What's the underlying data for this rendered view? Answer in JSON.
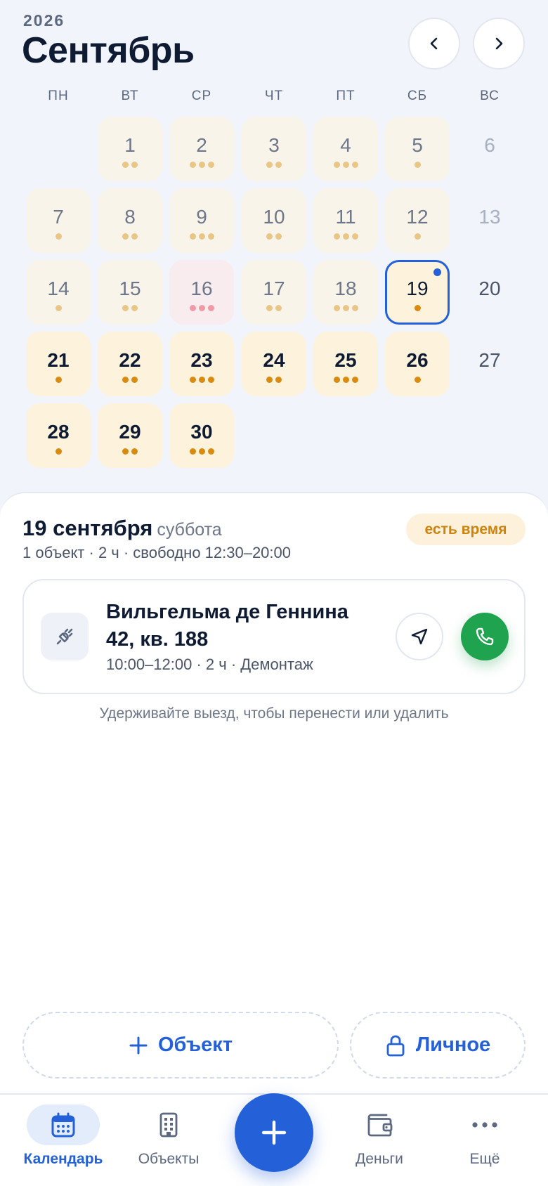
{
  "header": {
    "year": "2026",
    "month": "Сентябрь"
  },
  "weekdays": [
    "ПН",
    "ВТ",
    "СР",
    "ЧТ",
    "ПТ",
    "СБ",
    "ВС"
  ],
  "days": [
    {
      "day": "1",
      "dots": 2,
      "state": "past"
    },
    {
      "day": "2",
      "dots": 3,
      "state": "past"
    },
    {
      "day": "3",
      "dots": 2,
      "state": "past"
    },
    {
      "day": "4",
      "dots": 3,
      "state": "past"
    },
    {
      "day": "5",
      "dots": 1,
      "state": "past"
    },
    {
      "day": "6",
      "dots": 0,
      "state": "empty-past"
    },
    {
      "day": "7",
      "dots": 1,
      "state": "past"
    },
    {
      "day": "8",
      "dots": 2,
      "state": "past"
    },
    {
      "day": "9",
      "dots": 3,
      "state": "past"
    },
    {
      "day": "10",
      "dots": 2,
      "state": "past"
    },
    {
      "day": "11",
      "dots": 3,
      "state": "past"
    },
    {
      "day": "12",
      "dots": 1,
      "state": "past"
    },
    {
      "day": "13",
      "dots": 0,
      "state": "empty-past"
    },
    {
      "day": "14",
      "dots": 1,
      "state": "past"
    },
    {
      "day": "15",
      "dots": 2,
      "state": "past"
    },
    {
      "day": "16",
      "dots": 3,
      "state": "past-red"
    },
    {
      "day": "17",
      "dots": 2,
      "state": "past"
    },
    {
      "day": "18",
      "dots": 3,
      "state": "past"
    },
    {
      "day": "19",
      "dots": 1,
      "state": "today"
    },
    {
      "day": "20",
      "dots": 0,
      "state": "empty"
    },
    {
      "day": "21",
      "dots": 1,
      "state": "future"
    },
    {
      "day": "22",
      "dots": 2,
      "state": "future"
    },
    {
      "day": "23",
      "dots": 3,
      "state": "future"
    },
    {
      "day": "24",
      "dots": 2,
      "state": "future"
    },
    {
      "day": "25",
      "dots": 3,
      "state": "future"
    },
    {
      "day": "26",
      "dots": 1,
      "state": "future"
    },
    {
      "day": "27",
      "dots": 0,
      "state": "empty"
    },
    {
      "day": "28",
      "dots": 1,
      "state": "future"
    },
    {
      "day": "29",
      "dots": 2,
      "state": "future"
    },
    {
      "day": "30",
      "dots": 3,
      "state": "future"
    }
  ],
  "selected_day": {
    "date": "19 сентября",
    "weekday": "суббота",
    "summary": "1 объект · 2 ч · свободно 12:30–20:00",
    "badge": "есть время"
  },
  "job": {
    "address": "Вильгельма де Геннина 42, кв. 188",
    "meta": "10:00–12:00 · 2 ч · Демонтаж",
    "icon": "plug-icon"
  },
  "hint": "Удерживайте выезд, чтобы перенести или удалить",
  "actions": {
    "add_object": "Объект",
    "personal": "Личное"
  },
  "tabs": {
    "calendar": "Календарь",
    "objects": "Объекты",
    "money": "Деньги",
    "more": "Ещё"
  },
  "colors": {
    "accent": "#2461d9",
    "call": "#1fa34f",
    "busy_dot": "#d98b0f",
    "overbooked_dot": "#ef9aa6"
  }
}
